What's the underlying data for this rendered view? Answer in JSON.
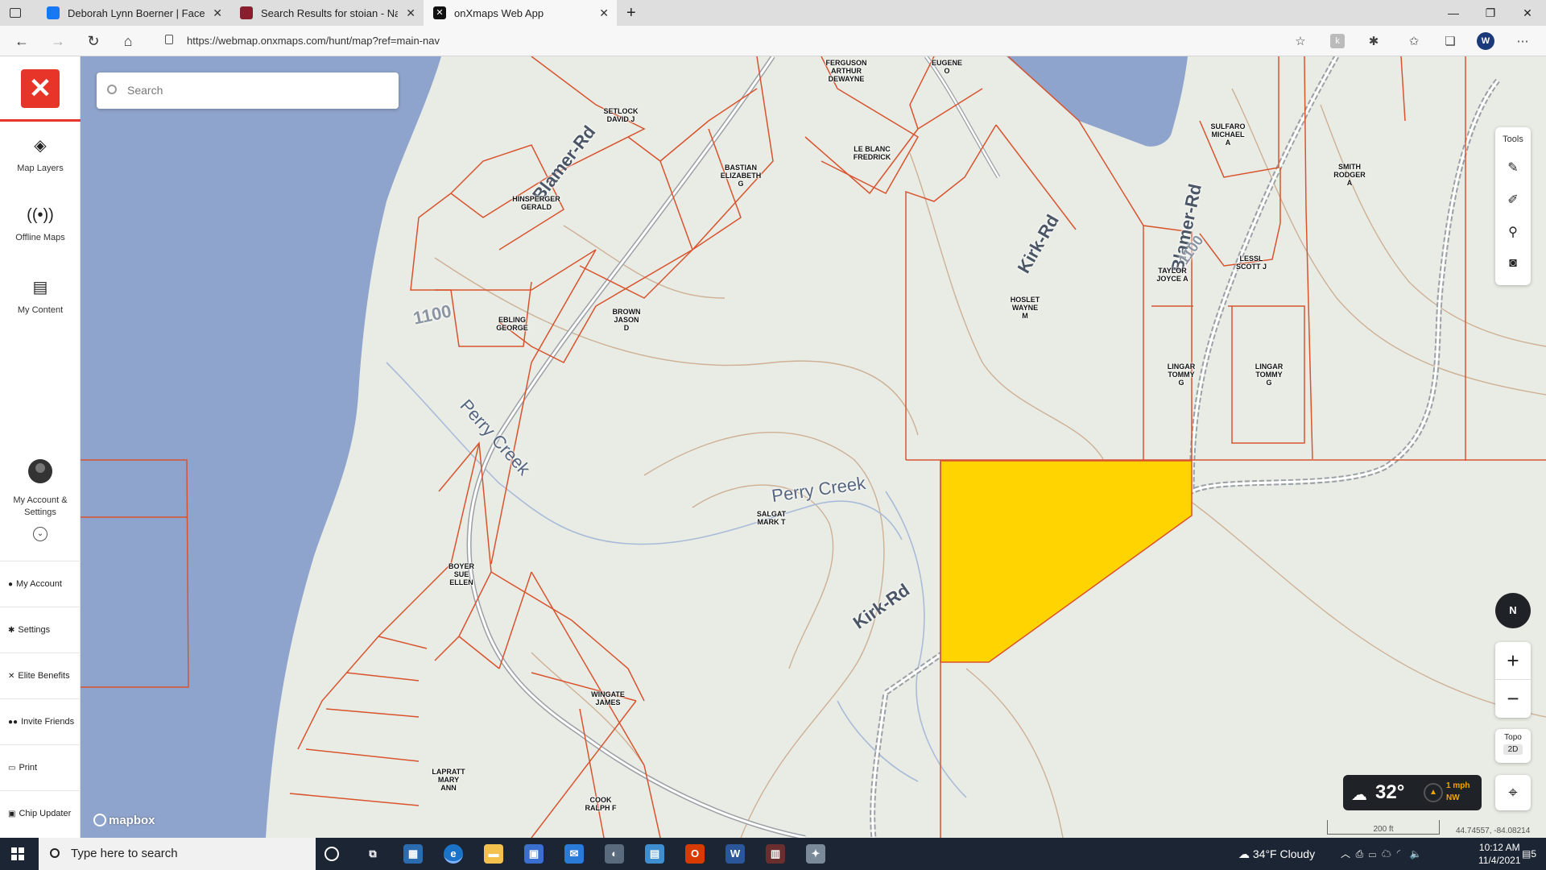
{
  "browser": {
    "tabs": [
      {
        "title": "Deborah Lynn Boerner | Facebook",
        "icon": "facebook-icon",
        "color": "#1877f2"
      },
      {
        "title": "Search Results for stoian - Name",
        "icon": "site-icon",
        "color": "#8b1e2e"
      },
      {
        "title": "onXmaps Web App",
        "icon": "onx-icon",
        "color": "#111111"
      }
    ],
    "new_tab": "+",
    "url": "https://webmap.onxmaps.com/hunt/map?ref=main-nav"
  },
  "sidebar": {
    "logo": "onx-logo",
    "nav": [
      {
        "label": "Map Layers",
        "icon": "layers-icon"
      },
      {
        "label": "Offline Maps",
        "icon": "broadcast-icon"
      },
      {
        "label": "My Content",
        "icon": "folder-icon"
      }
    ],
    "account_label": "My Account & Settings",
    "menu": [
      {
        "label": "My Account",
        "icon": "person-icon"
      },
      {
        "label": "Settings",
        "icon": "gear-icon"
      },
      {
        "label": "Elite Benefits",
        "icon": "x-icon"
      },
      {
        "label": "Invite Friends",
        "icon": "people-icon"
      },
      {
        "label": "Print",
        "icon": "printer-icon"
      },
      {
        "label": "Chip Updater",
        "icon": "chip-icon"
      }
    ]
  },
  "map": {
    "search_placeholder": "Search",
    "tools_label": "Tools",
    "compass_label": "N",
    "zoom_in": "+",
    "zoom_out": "−",
    "layer_label": "Topo",
    "layer_mode": "2D",
    "weather": {
      "temp": "32°",
      "wind_speed": "1 mph",
      "wind_dir": "NW"
    },
    "attribution": "mapbox",
    "scale_label": "200 ft",
    "coordinates": "44.74557, -84.08214",
    "colors": {
      "water": "#8fa4cc",
      "land": "#e9ece4",
      "parcel_line": "#d9532e",
      "highlight": "#ffd400",
      "contour": "#c9a98a",
      "stream": "#9fb4d6"
    },
    "road_labels": [
      "Blamer-Rd",
      "Kirk-Rd",
      "Kirk-Rd",
      "Blamer-Rd",
      "1100",
      "1100"
    ],
    "creek_labels": [
      "Perry Creek",
      "Perry Creek"
    ],
    "owners": [
      "FERGUSON\nARTHUR\nDEWAYNE",
      "EUGENE\nO",
      "SETLOCK\nDAVID J",
      "LE BLANC\nFREDRICK",
      "BASTIAN\nELIZABETH\nG",
      "HINSPERGER\nGERALD",
      "SULFARO\nMICHAEL\nA",
      "SMITH\nRODGER\nA",
      "TAYLOR\nJOYCE A",
      "LESSL\nSCOTT J",
      "HOSLET\nWAYNE\nM",
      "EBLING\nGEORGE",
      "BROWN\nJASON\nD",
      "LINGAR\nTOMMY\nG",
      "LINGAR\nTOMMY\nG",
      "SALGAT\nMARK T",
      "BOYER\nSUE\nELLEN",
      "WINGATE\nJAMES",
      "LAPRATT\nMARY\nANN",
      "COOK\nRALPH F"
    ]
  },
  "taskbar": {
    "search_placeholder": "Type here to search",
    "weather": "34°F  Cloudy",
    "time": "10:12 AM",
    "date": "11/4/2021",
    "notification_count": "5"
  }
}
